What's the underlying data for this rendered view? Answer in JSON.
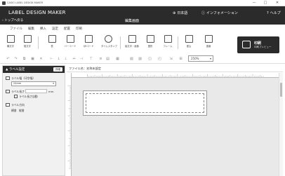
{
  "window": {
    "title": "CASIO LABEL DESIGN MAKER",
    "controls": [
      "—",
      "□",
      "✕"
    ]
  },
  "header": {
    "brand": "LABEL DESIGN MAKER",
    "links": {
      "language": "日本語",
      "info": "インフォメーション",
      "help": "ヘルプ"
    },
    "back": "トップへ戻る",
    "screen_title": "編集画面"
  },
  "menu": [
    "ファイル",
    "編集",
    "挿入",
    "設定",
    "配置",
    "印刷"
  ],
  "toolbar": {
    "tools": [
      {
        "label": "横文字",
        "icon": "horizontal-text-icon"
      },
      {
        "label": "縦文字",
        "icon": "vertical-text-icon"
      },
      {
        "label": "表",
        "icon": "table-icon"
      },
      {
        "label": "バーコード",
        "icon": "barcode-icon"
      },
      {
        "label": "QRコード",
        "icon": "qr-code-icon"
      },
      {
        "label": "タイムスタンプ",
        "icon": "clock-icon"
      },
      {
        "label": "絵文字・画像",
        "icon": "image-icon"
      },
      {
        "label": "図形",
        "icon": "shape-icon"
      },
      {
        "label": "フレーム",
        "icon": "frame-icon"
      },
      {
        "label": "差込",
        "icon": "merge-icon"
      },
      {
        "label": "連番",
        "icon": "serial-number-icon"
      }
    ],
    "print": {
      "label": "印刷",
      "sub": "印刷プレビュー"
    }
  },
  "format": {
    "zoom": "250%"
  },
  "panel": {
    "title": "ラベル設定",
    "title_button": "詳細",
    "tape_width_label": "ラベル幅（印字幅）",
    "tape_width_value": "24mm",
    "length_label": "ラベル長さ",
    "length_unit": "mm",
    "auto_length_label": "ラベル長さ自動",
    "direction_label": "ラベル方向",
    "direction_options": [
      "横書",
      "縦書"
    ]
  },
  "canvas": {
    "file_label": "ファイル名：名称未設定"
  }
}
